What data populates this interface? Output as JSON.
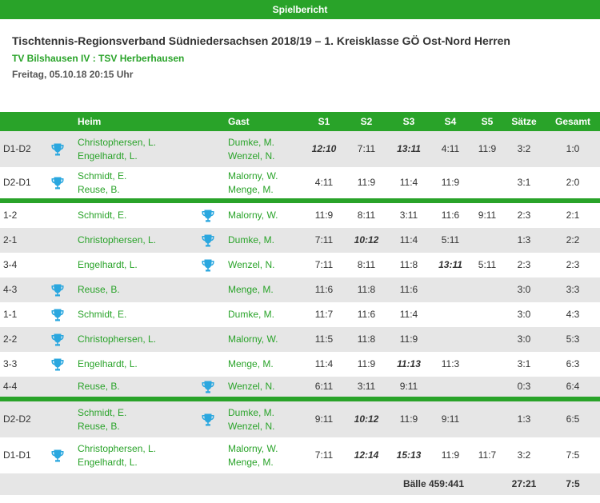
{
  "topbar": {
    "title": "Spielbericht"
  },
  "meta": {
    "league": "Tischtennis-Regionsverband Südniedersachsen 2018/19 – 1. Kreisklasse GÖ Ost-Nord Herren",
    "teams": "TV Bilshausen IV : TSV Herberhausen",
    "date": "Freitag, 05.10.18 20:15 Uhr"
  },
  "colors": {
    "accent": "#29a329",
    "row_alt": "#e6e6e6",
    "trophy": "#2aa7df"
  },
  "icons": {
    "winner": "trophy-icon"
  },
  "table": {
    "headers": {
      "heim": "Heim",
      "gast": "Gast",
      "s1": "S1",
      "s2": "S2",
      "s3": "S3",
      "s4": "S4",
      "s5": "S5",
      "saetze": "Sätze",
      "gesamt": "Gesamt"
    },
    "rows": [
      {
        "pair": "D1-D2",
        "heim": [
          "Christophersen, L.",
          "Engelhardt, L."
        ],
        "gast": [
          "Dumke, M.",
          "Wenzel, N."
        ],
        "winner": "heim",
        "sets": [
          "12:10",
          "7:11",
          "13:11",
          "4:11",
          "11:9"
        ],
        "emph": [
          true,
          false,
          true,
          false,
          false
        ],
        "saetze": "3:2",
        "gesamt": "1:0"
      },
      {
        "pair": "D2-D1",
        "heim": [
          "Schmidt, E.",
          "Reuse, B."
        ],
        "gast": [
          "Malorny, W.",
          "Menge, M."
        ],
        "winner": "heim",
        "sets": [
          "4:11",
          "11:9",
          "11:4",
          "11:9",
          ""
        ],
        "emph": [
          false,
          false,
          false,
          false,
          false
        ],
        "saetze": "3:1",
        "gesamt": "2:0"
      },
      {
        "pair": "1-2",
        "heim": [
          "Schmidt, E."
        ],
        "gast": [
          "Malorny, W."
        ],
        "winner": "gast",
        "sets": [
          "11:9",
          "8:11",
          "3:11",
          "11:6",
          "9:11"
        ],
        "emph": [
          false,
          false,
          false,
          false,
          false
        ],
        "saetze": "2:3",
        "gesamt": "2:1"
      },
      {
        "pair": "2-1",
        "heim": [
          "Christophersen, L."
        ],
        "gast": [
          "Dumke, M."
        ],
        "winner": "gast",
        "sets": [
          "7:11",
          "10:12",
          "11:4",
          "5:11",
          ""
        ],
        "emph": [
          false,
          true,
          false,
          false,
          false
        ],
        "saetze": "1:3",
        "gesamt": "2:2"
      },
      {
        "pair": "3-4",
        "heim": [
          "Engelhardt, L."
        ],
        "gast": [
          "Wenzel, N."
        ],
        "winner": "gast",
        "sets": [
          "7:11",
          "8:11",
          "11:8",
          "13:11",
          "5:11"
        ],
        "emph": [
          false,
          false,
          false,
          true,
          false
        ],
        "saetze": "2:3",
        "gesamt": "2:3"
      },
      {
        "pair": "4-3",
        "heim": [
          "Reuse, B."
        ],
        "gast": [
          "Menge, M."
        ],
        "winner": "heim",
        "sets": [
          "11:6",
          "11:8",
          "11:6",
          "",
          ""
        ],
        "emph": [
          false,
          false,
          false,
          false,
          false
        ],
        "saetze": "3:0",
        "gesamt": "3:3"
      },
      {
        "pair": "1-1",
        "heim": [
          "Schmidt, E."
        ],
        "gast": [
          "Dumke, M."
        ],
        "winner": "heim",
        "sets": [
          "11:7",
          "11:6",
          "11:4",
          "",
          ""
        ],
        "emph": [
          false,
          false,
          false,
          false,
          false
        ],
        "saetze": "3:0",
        "gesamt": "4:3"
      },
      {
        "pair": "2-2",
        "heim": [
          "Christophersen, L."
        ],
        "gast": [
          "Malorny, W."
        ],
        "winner": "heim",
        "sets": [
          "11:5",
          "11:8",
          "11:9",
          "",
          ""
        ],
        "emph": [
          false,
          false,
          false,
          false,
          false
        ],
        "saetze": "3:0",
        "gesamt": "5:3"
      },
      {
        "pair": "3-3",
        "heim": [
          "Engelhardt, L."
        ],
        "gast": [
          "Menge, M."
        ],
        "winner": "heim",
        "sets": [
          "11:4",
          "11:9",
          "11:13",
          "11:3",
          ""
        ],
        "emph": [
          false,
          false,
          true,
          false,
          false
        ],
        "saetze": "3:1",
        "gesamt": "6:3"
      },
      {
        "pair": "4-4",
        "heim": [
          "Reuse, B."
        ],
        "gast": [
          "Wenzel, N."
        ],
        "winner": "gast",
        "sets": [
          "6:11",
          "3:11",
          "9:11",
          "",
          ""
        ],
        "emph": [
          false,
          false,
          false,
          false,
          false
        ],
        "saetze": "0:3",
        "gesamt": "6:4"
      },
      {
        "pair": "D2-D2",
        "heim": [
          "Schmidt, E.",
          "Reuse, B."
        ],
        "gast": [
          "Dumke, M.",
          "Wenzel, N."
        ],
        "winner": "gast",
        "sets": [
          "9:11",
          "10:12",
          "11:9",
          "9:11",
          ""
        ],
        "emph": [
          false,
          true,
          false,
          false,
          false
        ],
        "saetze": "1:3",
        "gesamt": "6:5"
      },
      {
        "pair": "D1-D1",
        "heim": [
          "Christophersen, L.",
          "Engelhardt, L."
        ],
        "gast": [
          "Malorny, W.",
          "Menge, M."
        ],
        "winner": "heim",
        "sets": [
          "7:11",
          "12:14",
          "15:13",
          "11:9",
          "11:7"
        ],
        "emph": [
          false,
          true,
          true,
          false,
          false
        ],
        "saetze": "3:2",
        "gesamt": "7:5"
      }
    ],
    "footer": {
      "baelle": "Bälle 459:441",
      "saetze": "27:21",
      "gesamt": "7:5"
    }
  }
}
